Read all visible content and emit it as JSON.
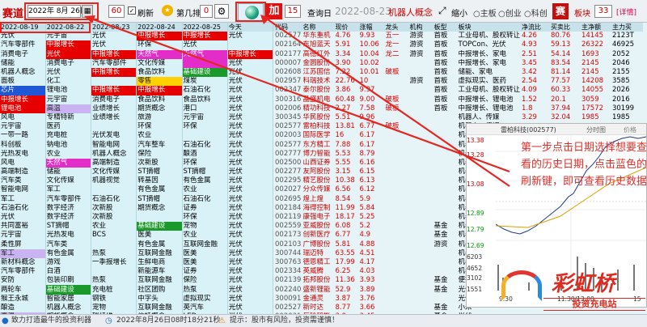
{
  "toolbar": {
    "title": "赛道",
    "date_value": "2022年 8月 26日",
    "calendar_icon": "calendar-icon",
    "count_60": "60",
    "refresh_label": "刷新",
    "rank_label": "第几排",
    "rank_value": "0",
    "add_label": "加",
    "count_15": "15",
    "query_label": "查询日",
    "query_date": "2022-08-23",
    "concept": "机器人概念",
    "shrink_label": "缩小",
    "opt_main": "主板",
    "opt_gem": "创业",
    "opt_star": "科创",
    "board_label": "板块",
    "board_value": "33",
    "full_label": "[详情]",
    "sai_label": "赛"
  },
  "left": {
    "headers": [
      "2022-08-19",
      "2022-08-22",
      "2022-08-23",
      "2022-08-24",
      "2022-08-25",
      "今天"
    ],
    "rows": [
      [
        "光伏",
        "元宇宙",
        "光伏",
        "中报增长",
        "中报增长",
        "光伏"
      ],
      [
        "汽车零部件",
        "中报增长",
        "光伏",
        "环保",
        "光伏",
        ""
      ],
      [
        "消费电子",
        "光伏",
        "中报增长",
        "天然气",
        "天然气",
        "中报增长"
      ],
      [
        "储能",
        "消费电子",
        "汽车零部件",
        "文化传媒",
        "",
        "光伏"
      ],
      [
        "机器人概念",
        "光伏",
        "中报增长",
        "食品饮料",
        "基础建设",
        "光伏"
      ],
      [
        "面板",
        "化工",
        "",
        "零售",
        "煤炭",
        "光伏"
      ],
      [
        "芯片",
        "锂电池",
        "中报增长",
        "中报增长",
        "石油石化",
        "光伏"
      ],
      [
        "中报增长",
        "元宇宙",
        "消费电子",
        "食品饮料",
        "食品饮料",
        "光伏"
      ],
      [
        "锂电池",
        "高温",
        "业绩增长",
        "期货概念",
        "港口",
        "光伏"
      ],
      [
        "风电",
        "专精特新",
        "业绩增长",
        "旅游",
        "元宇宙",
        "光伏"
      ],
      [
        "元宇宙",
        "医药",
        "",
        "环保",
        "环保",
        "光伏"
      ],
      [
        "一带一路",
        "充电桩",
        "光伏发电",
        "农业",
        "",
        "光伏"
      ],
      [
        "科创板",
        "钠电池",
        "智能电网",
        "汽车整车",
        "石油石化",
        "光伏"
      ],
      [
        "光热发电",
        "农业",
        "机器人概念",
        "保险",
        "酿酒",
        "光伏"
      ],
      [
        "风电",
        "天然气",
        "高端制造",
        "次新股",
        "环保",
        "光伏"
      ],
      [
        "高端制造",
        "储能",
        "文化传媒",
        "ST摘帽",
        "ST摘帽",
        "光伏"
      ],
      [
        "汽车类",
        "文化传媒",
        "机器视觉",
        "转基因",
        "有色金属",
        "光伏"
      ],
      [
        "智能电网",
        "军工",
        "",
        "有色金属",
        "农业",
        "光伏"
      ],
      [
        "军工",
        "汽车零部件",
        "石油石化",
        "ST摘帽",
        "石油石化",
        "光伏"
      ],
      [
        "石油石化",
        "数字经济",
        "次新股",
        "期货概念",
        "证券",
        "光伏"
      ],
      [
        "光伏",
        "数字经济",
        "次新股",
        "",
        "环保",
        "光伏"
      ],
      [
        "共同富裕",
        "ST摘帽",
        "农业",
        "基础建设",
        "宠物",
        "光伏"
      ],
      [
        "元宇宙",
        "光热发电",
        "BCS",
        "医美",
        "农业",
        "光伏"
      ],
      [
        "柔性屏",
        "汽车类",
        "",
        "有色金属",
        "互联网金融",
        "光伏"
      ],
      [
        "军工",
        "有色金属",
        "热泵",
        "互联网金融",
        "医美",
        "光伏"
      ],
      [
        "新材料概念",
        "游戏",
        "一季报增长",
        "生鲜电商",
        "医美",
        "光伏"
      ],
      [
        "汽车零部件",
        "白酒",
        "",
        "新能源车",
        "证券",
        "光伏"
      ],
      [
        "安防",
        "包装印刷",
        "热泵",
        "互联网金融",
        "保险",
        "光伏"
      ],
      [
        "两轮车",
        "基础建设",
        "充电桩",
        "社区团购",
        "热泵",
        "光伏"
      ],
      [
        "猴王永城",
        "智能家居",
        "钢铁",
        "中字头",
        "虚拟现实",
        "光伏"
      ],
      [
        "酿造",
        "机器人概念",
        "宠物",
        "互联网金融",
        "英汽车",
        "光伏"
      ],
      [
        "高温",
        "期货概念",
        "碳纤维",
        "信托概念",
        "LED",
        "光伏"
      ],
      [
        "汽车类",
        "热泵",
        "石墨化",
        "化妆品概念",
        "LED",
        "光伏"
      ],
      [
        "有色金属",
        "房地产",
        "钠电池",
        "有色金属",
        "医药",
        "光伏"
      ]
    ]
  },
  "right": {
    "headers": [
      "代码",
      "名称",
      "现价",
      "涨幅",
      "龙头",
      "机构",
      "板型",
      "板块",
      "净流比",
      "买卖比",
      "主净额",
      "主力买"
    ],
    "rows": [
      [
        "002577",
        "华东重机",
        "4.76",
        "9.93",
        "五一",
        "游资",
        "首板",
        "工业母机、股权转让",
        "4.26",
        "80.76",
        "14145",
        "2123T"
      ],
      [
        "002164",
        "东旭蓝天",
        "5.91",
        "10.06",
        "龙一",
        "游资",
        "首板",
        "TOPCon、光伏",
        "4.93",
        "59.13",
        "26322",
        "46925"
      ],
      [
        "002177",
        "高德红外",
        "3.34",
        "10.04",
        "龙二",
        "游资",
        "首板",
        "中报增长、家电",
        "2.51",
        "54.14",
        "1693",
        "2052"
      ],
      [
        "000007",
        "金圆股份",
        "3.90",
        "10.02",
        "",
        "",
        "首板",
        "中报增长、家电",
        "3.45",
        "83.54",
        "2145",
        "2046"
      ],
      [
        "002608",
        "江苏国信",
        "7.22",
        "10.01",
        "破板",
        "",
        "首板",
        "储能、家电",
        "3.42",
        "81.14",
        "2145",
        "2155"
      ],
      [
        "002957",
        "科瑞技术",
        "22.76",
        "10",
        "",
        "游资",
        "首板",
        "虚拟现实、医药",
        "2.54",
        "77.57",
        "14208",
        "3585"
      ],
      [
        "002347",
        "泰尔股份",
        "3.86",
        "9.97",
        "",
        "",
        "首板",
        "工业母机、股权转让",
        "4.09",
        "60.33",
        "14055",
        "2026"
      ],
      [
        "300316",
        "晶盛机电",
        "60.48",
        "9.00",
        "破板",
        "",
        "首板",
        "中报增长、锂电池",
        "1.52",
        "20.1",
        "3059",
        "2016"
      ],
      [
        "002006",
        "精功科技",
        "2.27",
        "7.58",
        "破板",
        "",
        "首板",
        "中报增长、锂电池",
        "1.8",
        "37.94",
        "17572",
        "30199"
      ],
      [
        "300345",
        "华民股份",
        "5.51",
        "9.96",
        "",
        "",
        "",
        "机器人、传媒",
        "3.29",
        "32.04",
        "1985",
        "1985"
      ],
      [
        "002577",
        "雷柏科技",
        "13.81",
        "6.77",
        "破板",
        "",
        "",
        "机器人、传媒",
        "",
        "",
        "",
        ""
      ],
      [
        "002003",
        "国际医学",
        "16",
        "6.17",
        "",
        "",
        "",
        "机器人",
        "",
        "",
        "",
        ""
      ],
      [
        "002577",
        "东方精工",
        "7.88",
        "6.17",
        "",
        "",
        "",
        "机器人",
        "",
        "",
        "",
        ""
      ],
      [
        "002777",
        "博力智能",
        "5.53",
        "8.79",
        "",
        "",
        "",
        "机器人",
        "",
        "",
        "",
        ""
      ],
      [
        "002500",
        "山西证券",
        "5.55",
        "6.16",
        "",
        "",
        "",
        "机器人",
        "",
        "",
        "",
        ""
      ],
      [
        "002277",
        "友阿股份",
        "3.15",
        "6.15",
        "",
        "",
        "",
        "机器人",
        "",
        "",
        "",
        ""
      ],
      [
        "002295",
        "精艺股份",
        "10.38",
        "6.13",
        "",
        "",
        "",
        "机器人",
        "",
        "",
        "",
        ""
      ],
      [
        "002027",
        "分众传媒",
        "6.56",
        "6.12",
        "",
        "",
        "",
        "机器人",
        "",
        "",
        "",
        ""
      ],
      [
        "002695",
        "煌上煌",
        "8.54",
        "5.9",
        "",
        "",
        "",
        "机器人",
        "",
        "",
        "",
        ""
      ],
      [
        "002184",
        "海得控制",
        "11.99",
        "5.84",
        "",
        "",
        "",
        "机器人",
        "",
        "",
        "",
        ""
      ],
      [
        "002119",
        "康强电子",
        "18.17",
        "5.25",
        "",
        "",
        "",
        "机器人",
        "",
        "",
        "",
        ""
      ],
      [
        "002559",
        "亚威股份",
        "6.08",
        "5.2",
        "",
        "",
        "基金",
        "机器人",
        "",
        "",
        "",
        ""
      ],
      [
        "002173",
        "创新医疗",
        "6.77",
        "4.9",
        "",
        "",
        "基金",
        "机器人",
        "",
        "",
        "",
        ""
      ],
      [
        "002103",
        "广博股份",
        "5.81",
        "4.88",
        "",
        "",
        "游资",
        "机器人",
        "",
        "",
        "",
        ""
      ],
      [
        "300744",
        "瑞迈特",
        "63.55",
        "4.51",
        "",
        "",
        "",
        "机器人",
        "",
        "",
        "",
        ""
      ],
      [
        "300763",
        "德恩精工",
        "17.99",
        "4.17",
        "",
        "",
        "",
        "机器人",
        "",
        "",
        "",
        ""
      ],
      [
        "002334",
        "英威腾",
        "6.25",
        "4.03",
        "",
        "",
        "",
        "机器人",
        "",
        "",
        "",
        ""
      ],
      [
        "002139",
        "拓邦股份",
        "11.36",
        "3.93",
        "",
        "",
        "基金",
        "便携",
        "",
        "",
        "",
        ""
      ],
      [
        "002240",
        "盛新锂能",
        "52.9",
        "3.89",
        "",
        "",
        "基金",
        "光伏",
        "",
        "",
        "",
        ""
      ],
      [
        "300091",
        "金通灵",
        "3.87",
        "3.76",
        "",
        "",
        "",
        "光伏",
        "",
        "",
        "",
        ""
      ],
      [
        "002527",
        "新时达",
        "8.77",
        "3.66",
        "",
        "",
        "基金",
        "小米",
        "",
        "",
        "",
        ""
      ],
      [
        "002031",
        "巨轮智能",
        "3.9",
        "3.45",
        "",
        "",
        "基金",
        "光伏",
        "",
        "",
        "",
        ""
      ],
      [
        "002757",
        "五洲新春",
        "14.29",
        "3.08",
        "",
        "",
        "",
        "光伏",
        "",
        "",
        "",
        ""
      ],
      [
        "002686",
        "亿利达",
        "9.08",
        "3.02",
        "",
        "",
        "",
        "光伏",
        "",
        "",
        "",
        ""
      ]
    ]
  },
  "status": {
    "left": "致力打造最牛的投资利器",
    "date_text": "2022年8月26日08时18分21秒",
    "hint": "提示：股市有风险，投资需谨慎！"
  },
  "popup": {
    "title": "雷柏科技(002577)",
    "tab1": "分时图",
    "tab2": "价格",
    "prices": [
      "13.38",
      "13.28",
      "13.08",
      "12.89",
      "12.79",
      "12.69"
    ],
    "vols": [
      "6203",
      "4652",
      "3102",
      "1551"
    ],
    "times": [
      "9:30",
      "11:30/13:00",
      "15"
    ]
  },
  "annotation": {
    "text": "第一步点击日期选择想要查看的历史日期，点击蓝色的刷新键，即可查看历史数据"
  },
  "logo": {
    "name": "彩虹桥",
    "subtitle": "投资充电站"
  },
  "colors": {
    "accent_red": "#e5261f",
    "up": "#d00000",
    "down": "#009900",
    "highlight_green": "#1a9a2a",
    "highlight_pink": "#e42dc8"
  }
}
